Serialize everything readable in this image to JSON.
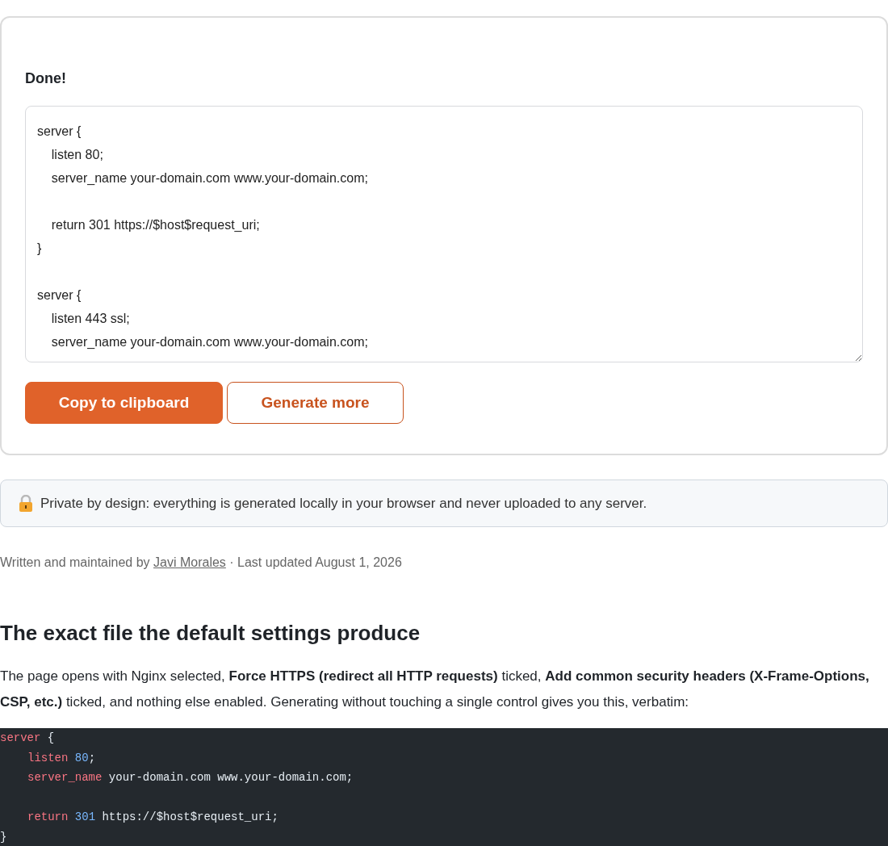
{
  "result": {
    "heading": "Done!",
    "output_field": {
      "value": "server {\n    listen 80;\n    server_name your-domain.com www.your-domain.com;\n\n    return 301 https://$host$request_uri;\n}\n\nserver {\n    listen 443 ssl;\n    server_name your-domain.com www.your-domain.com;"
    },
    "buttons": [
      {
        "label": "Copy to clipboard",
        "kind": "primary"
      },
      {
        "label": "Generate more",
        "kind": "outline"
      }
    ]
  },
  "privacy_note": "Private by design: everything is generated locally in your browser and never uploaded to any server.",
  "byline": {
    "prefix": "Written and maintained by",
    "author": "Javi Morales",
    "separator": "·",
    "updated": "Last updated August 1, 2026"
  },
  "article": {
    "heading": "The exact file the default settings produce",
    "paragraph": "The page opens with Nginx selected, **Force HTTPS (redirect all HTTP requests)** ticked, **Add common security headers (X-Frame-Options, CSP, etc.)** ticked, and nothing else enabled. Generating without touching a single control gives you this, verbatim:",
    "code_lines": [
      {
        "kind": "code",
        "indent": false,
        "tokens": [
          {
            "kind": "keyword",
            "text": "server"
          },
          {
            "kind": "plain",
            "text": " {"
          }
        ]
      },
      {
        "kind": "code",
        "indent": true,
        "tokens": [
          {
            "kind": "keyword",
            "text": "listen"
          },
          {
            "kind": "number",
            "text": " 80"
          },
          {
            "kind": "plain",
            "text": ";"
          }
        ]
      },
      {
        "kind": "code",
        "indent": true,
        "tokens": [
          {
            "kind": "keyword",
            "text": "server_name"
          },
          {
            "kind": "plain",
            "text": " your-domain.com www.your-domain.com;"
          }
        ]
      },
      {
        "kind": "blank"
      },
      {
        "kind": "code",
        "indent": true,
        "tokens": [
          {
            "kind": "keyword",
            "text": "return"
          },
          {
            "kind": "number",
            "text": " 301"
          },
          {
            "kind": "plain",
            "text": " https://$host$request_uri;"
          }
        ]
      },
      {
        "kind": "code",
        "indent": false,
        "tokens": [
          {
            "kind": "plain",
            "text": "}"
          }
        ]
      }
    ]
  }
}
